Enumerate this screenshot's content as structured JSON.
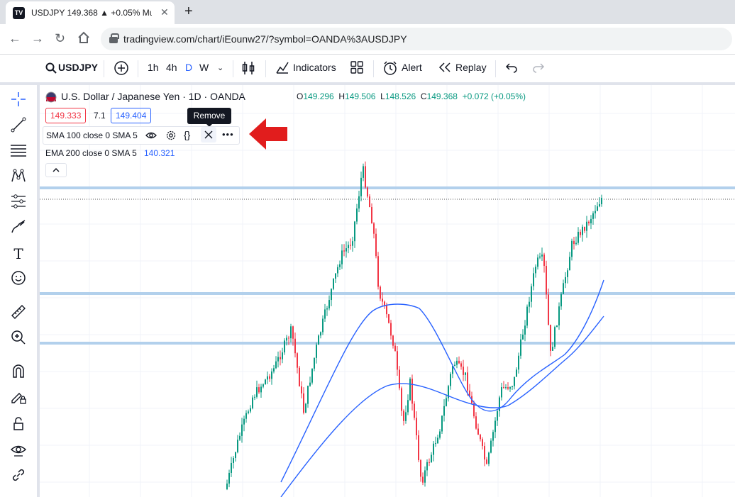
{
  "browser": {
    "tab_title": "USDJPY 149.368 ▲ +0.05% Multi",
    "tab_favicon": "TV",
    "url": "tradingview.com/chart/iEounw27/?symbol=OANDA%3AUSDJPY"
  },
  "header": {
    "symbol": "USDJPY",
    "intervals": [
      "1h",
      "4h",
      "D",
      "W"
    ],
    "indicators_label": "Indicators",
    "alert_label": "Alert",
    "replay_label": "Replay"
  },
  "legend": {
    "title": "U.S. Dollar / Japanese Yen · 1D · OANDA",
    "open_label": "O",
    "open": "149.296",
    "high_label": "H",
    "high": "149.506",
    "low_label": "L",
    "low": "148.526",
    "close_label": "C",
    "close": "149.368",
    "change": "+0.072 (+0.05%)",
    "sell_price": "149.333",
    "spread": "7.1",
    "buy_price": "149.404"
  },
  "indicators": {
    "sma_label": "SMA 100 close 0 SMA 5",
    "ema_label": "EMA 200 close 0 SMA 5",
    "ema_value": "140.321",
    "remove_tooltip": "Remove"
  },
  "colors": {
    "up": "#089981",
    "down": "#f23645",
    "ma_line": "#2962ff",
    "hline": "#b2d0ec",
    "annotation_arrow": "#e11d1d"
  }
}
